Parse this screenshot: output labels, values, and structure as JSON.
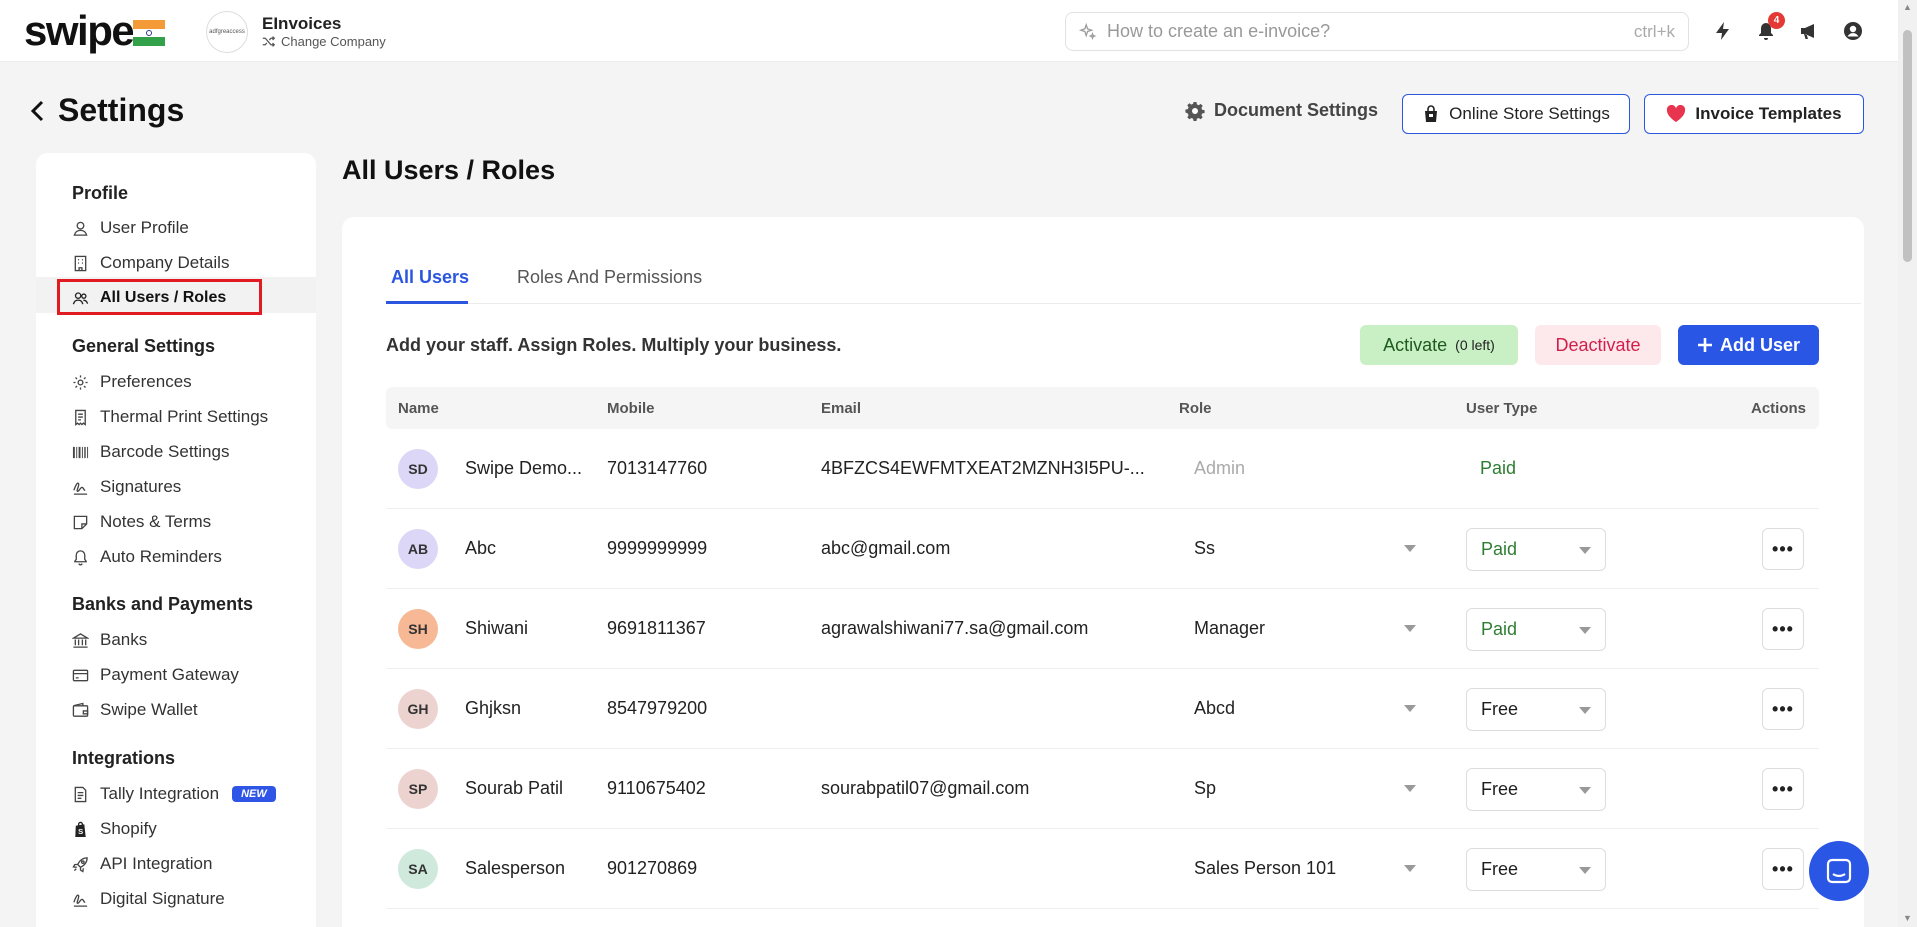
{
  "header": {
    "logo": "swipe",
    "company_logo_text": "adfgreaccess",
    "company_name": "EInvoices",
    "change_company": "Change Company",
    "search_placeholder": "How to create an e-invoice?",
    "search_shortcut": "ctrl+k",
    "notification_count": "4"
  },
  "page": {
    "title": "Settings",
    "document_settings": "Document Settings",
    "online_store_settings": "Online Store Settings",
    "invoice_templates": "Invoice Templates"
  },
  "sidebar": {
    "sections": [
      {
        "title": "Profile",
        "items": [
          "User Profile",
          "Company Details",
          "All Users / Roles"
        ]
      },
      {
        "title": "General Settings",
        "items": [
          "Preferences",
          "Thermal Print Settings",
          "Barcode Settings",
          "Signatures",
          "Notes & Terms",
          "Auto Reminders"
        ]
      },
      {
        "title": "Banks and Payments",
        "items": [
          "Banks",
          "Payment Gateway",
          "Swipe Wallet"
        ]
      },
      {
        "title": "Integrations",
        "items": [
          "Tally Integration",
          "Shopify",
          "API Integration",
          "Digital Signature"
        ]
      }
    ],
    "new_tag": "NEW"
  },
  "main": {
    "title": "All Users / Roles",
    "tabs": [
      "All Users",
      "Roles And Permissions"
    ],
    "tagline": "Add your staff. Assign Roles. Multiply your business.",
    "activate_label": "Activate",
    "activate_note": "(0 left)",
    "deactivate_label": "Deactivate",
    "add_user_label": "Add User",
    "columns": [
      "Name",
      "Mobile",
      "Email",
      "Role",
      "User Type",
      "Actions"
    ],
    "rows": [
      {
        "initials": "SD",
        "name": "Swipe Demo...",
        "mobile": "7013147760",
        "email": "4BFZCS4EWFMTXEAT2MZNH3I5PU-...",
        "role": "Admin",
        "user_type": "Paid"
      },
      {
        "initials": "AB",
        "name": "Abc",
        "mobile": "9999999999",
        "email": "abc@gmail.com",
        "role": "Ss",
        "user_type": "Paid"
      },
      {
        "initials": "SH",
        "name": "Shiwani",
        "mobile": "9691811367",
        "email": "agrawalshiwani77.sa@gmail.com",
        "role": "Manager",
        "user_type": "Paid"
      },
      {
        "initials": "GH",
        "name": "Ghjksn",
        "mobile": "8547979200",
        "email": "",
        "role": "Abcd",
        "user_type": "Free"
      },
      {
        "initials": "SP",
        "name": "Sourab Patil",
        "mobile": "9110675402",
        "email": "sourabpatil07@gmail.com",
        "role": "Sp",
        "user_type": "Free"
      },
      {
        "initials": "SA",
        "name": "Salesperson",
        "mobile": "901270869",
        "email": "",
        "role": "Sales Person 101",
        "user_type": "Free"
      }
    ],
    "more_label": "•••"
  },
  "colors": {
    "accent": "#2a56e6",
    "paid": "#2e7d32",
    "free": "#222222",
    "avatar_sd": "#dcd6f7",
    "avatar_ab": "#dcd6f7",
    "avatar_sh": "#f7b896",
    "avatar_gh": "#ecd3cf",
    "avatar_sp": "#ecd3cf",
    "avatar_sa": "#cfe9dd",
    "highlight_box": "#e11b22"
  }
}
